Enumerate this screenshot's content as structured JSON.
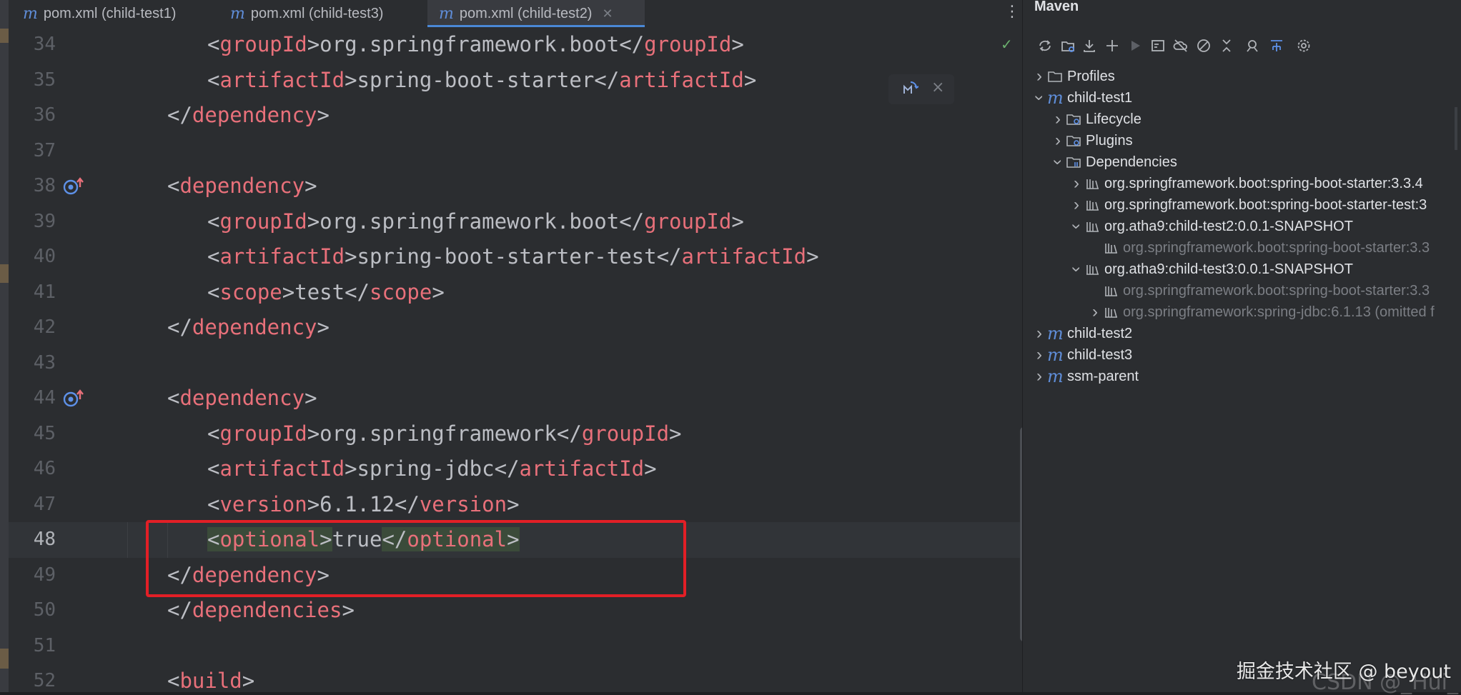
{
  "tabs": [
    {
      "label": "pom.xml (child-test1)",
      "active": false
    },
    {
      "label": "pom.xml (child-test3)",
      "active": false
    },
    {
      "label": "pom.xml (child-test2)",
      "active": true
    }
  ],
  "editor": {
    "lines": [
      {
        "num": "34",
        "indent": 2,
        "tag": "groupId",
        "text": "org.springframework.boot"
      },
      {
        "num": "35",
        "indent": 2,
        "tag": "artifactId",
        "text": "spring-boot-starter"
      },
      {
        "num": "36",
        "indent": 1,
        "close": "dependency"
      },
      {
        "num": "37"
      },
      {
        "num": "38",
        "indent": 1,
        "open": "dependency",
        "gutter": "override-icon"
      },
      {
        "num": "39",
        "indent": 2,
        "tag": "groupId",
        "text": "org.springframework.boot"
      },
      {
        "num": "40",
        "indent": 2,
        "tag": "artifactId",
        "text": "spring-boot-starter-test"
      },
      {
        "num": "41",
        "indent": 2,
        "tag": "scope",
        "text": "test"
      },
      {
        "num": "42",
        "indent": 1,
        "close": "dependency"
      },
      {
        "num": "43"
      },
      {
        "num": "44",
        "indent": 1,
        "open": "dependency",
        "gutter": "override-icon"
      },
      {
        "num": "45",
        "indent": 2,
        "tag": "groupId",
        "text": "org.springframework"
      },
      {
        "num": "46",
        "indent": 2,
        "tag": "artifactId",
        "text": "spring-jdbc"
      },
      {
        "num": "47",
        "indent": 2,
        "tag": "version",
        "text": "6.1.12"
      },
      {
        "num": "48",
        "indent": 2,
        "tag": "optional",
        "text": "true",
        "current": true,
        "highlight": true
      },
      {
        "num": "49",
        "indent": 1,
        "close": "dependency"
      },
      {
        "num": "50",
        "indent": 0,
        "close": "dependencies"
      },
      {
        "num": "51"
      },
      {
        "num": "52",
        "indent": 0,
        "open": "build"
      }
    ]
  },
  "maven": {
    "title": "Maven",
    "toolbar": [
      "reload-icon",
      "reload-sources-icon",
      "download-icon",
      "add-icon",
      "run-icon",
      "execute-goal-icon",
      "offline-icon",
      "skip-tests-icon",
      "collapse-icon",
      "analyze-icon",
      "show-dependencies-icon",
      "settings-icon"
    ],
    "tree": [
      {
        "label": "Profiles",
        "depth": 0,
        "chev": "right",
        "icon": "folder"
      },
      {
        "label": "child-test1",
        "depth": 0,
        "chev": "down",
        "icon": "m"
      },
      {
        "label": "Lifecycle",
        "depth": 1,
        "chev": "right",
        "icon": "folder-gear"
      },
      {
        "label": "Plugins",
        "depth": 1,
        "chev": "right",
        "icon": "folder-gear"
      },
      {
        "label": "Dependencies",
        "depth": 1,
        "chev": "down",
        "icon": "folder-lib"
      },
      {
        "label": "org.springframework.boot:spring-boot-starter:3.3.4",
        "depth": 2,
        "chev": "right",
        "icon": "lib"
      },
      {
        "label": "org.springframework.boot:spring-boot-starter-test:3",
        "depth": 2,
        "chev": "right",
        "icon": "lib"
      },
      {
        "label": "org.atha9:child-test2:0.0.1-SNAPSHOT",
        "depth": 2,
        "chev": "down",
        "icon": "lib"
      },
      {
        "label": "org.springframework.boot:spring-boot-starter:3.3",
        "depth": 3,
        "chev": "none",
        "icon": "lib",
        "dim": true
      },
      {
        "label": "org.atha9:child-test3:0.0.1-SNAPSHOT",
        "depth": 2,
        "chev": "down",
        "icon": "lib"
      },
      {
        "label": "org.springframework.boot:spring-boot-starter:3.3",
        "depth": 3,
        "chev": "none",
        "icon": "lib",
        "dim": true
      },
      {
        "label": "org.springframework:spring-jdbc:6.1.13 (omitted f",
        "depth": 3,
        "chev": "right",
        "icon": "lib",
        "dim": true
      },
      {
        "label": "child-test2",
        "depth": 0,
        "chev": "right",
        "icon": "m"
      },
      {
        "label": "child-test3",
        "depth": 0,
        "chev": "right",
        "icon": "m"
      },
      {
        "label": "ssm-parent",
        "depth": 0,
        "chev": "right",
        "icon": "m"
      }
    ]
  },
  "watermark": "掘金技术社区 @ beyout",
  "watermark_shadow": "CSDN @_Hui_"
}
